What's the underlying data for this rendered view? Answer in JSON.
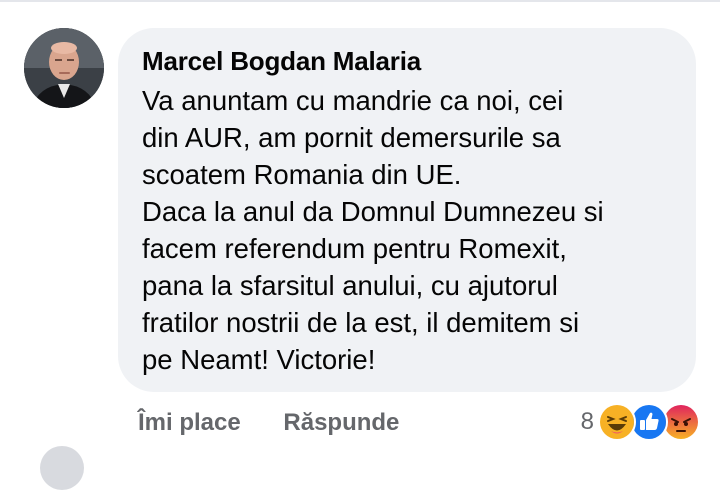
{
  "comment": {
    "author": "Marcel Bogdan Malaria",
    "text_lines": [
      "Va anuntam cu mandrie ca noi, cei",
      "din AUR, am pornit demersurile sa",
      "scoatem Romania din UE.",
      "Daca la anul da Domnul Dumnezeu si",
      "facem referendum pentru Romexit,",
      "pana la sfarsitul anului, cu ajutorul",
      "fratilor nostrii de la est, il demitem si",
      "pe Neamt! Victorie!"
    ]
  },
  "actions": {
    "like_label": "Îmi place",
    "reply_label": "Răspunde"
  },
  "reactions": {
    "count": "8",
    "types": [
      "haha-icon",
      "like-icon",
      "angry-icon"
    ]
  },
  "colors": {
    "bubble_bg": "#f0f2f5",
    "text": "#050505",
    "secondary_text": "#65676b",
    "like_blue": "#1877f2",
    "haha_yellow": "#f7b125",
    "angry_red": "#e9710f"
  }
}
